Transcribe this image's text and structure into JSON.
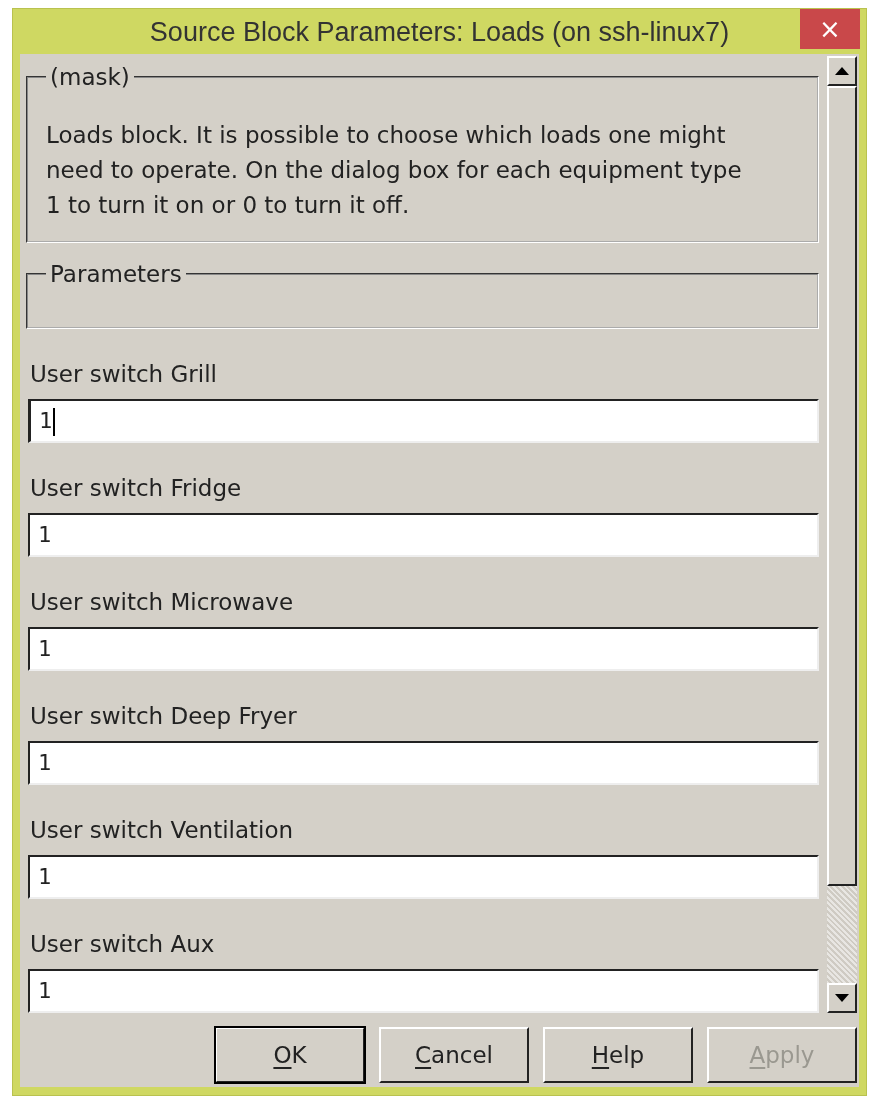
{
  "window": {
    "title": "Source Block Parameters: Loads (on ssh-linux7)",
    "close": "×"
  },
  "mask": {
    "legend": "(mask)",
    "description": "Loads block. It is possible to choose which loads one might need to operate. On the dialog box for each equipment type 1 to turn it on or 0 to turn it off."
  },
  "parameters": {
    "legend": "Parameters"
  },
  "fields": [
    {
      "label": "User switch Grill",
      "value": "1",
      "focused": true
    },
    {
      "label": "User switch Fridge",
      "value": "1",
      "focused": false
    },
    {
      "label": "User switch Microwave",
      "value": "1",
      "focused": false
    },
    {
      "label": "User switch Deep Fryer",
      "value": "1",
      "focused": false
    },
    {
      "label": "User switch Ventilation",
      "value": "1",
      "focused": false
    },
    {
      "label": "User switch Aux",
      "value": "1",
      "focused": false
    }
  ],
  "buttons": [
    {
      "key": "O",
      "rest": "K",
      "default": true,
      "disabled": false
    },
    {
      "key": "C",
      "rest": "ancel",
      "default": false,
      "disabled": false
    },
    {
      "key": "H",
      "rest": "elp",
      "default": false,
      "disabled": false
    },
    {
      "key": "A",
      "rest": "pply",
      "default": false,
      "disabled": true
    }
  ]
}
